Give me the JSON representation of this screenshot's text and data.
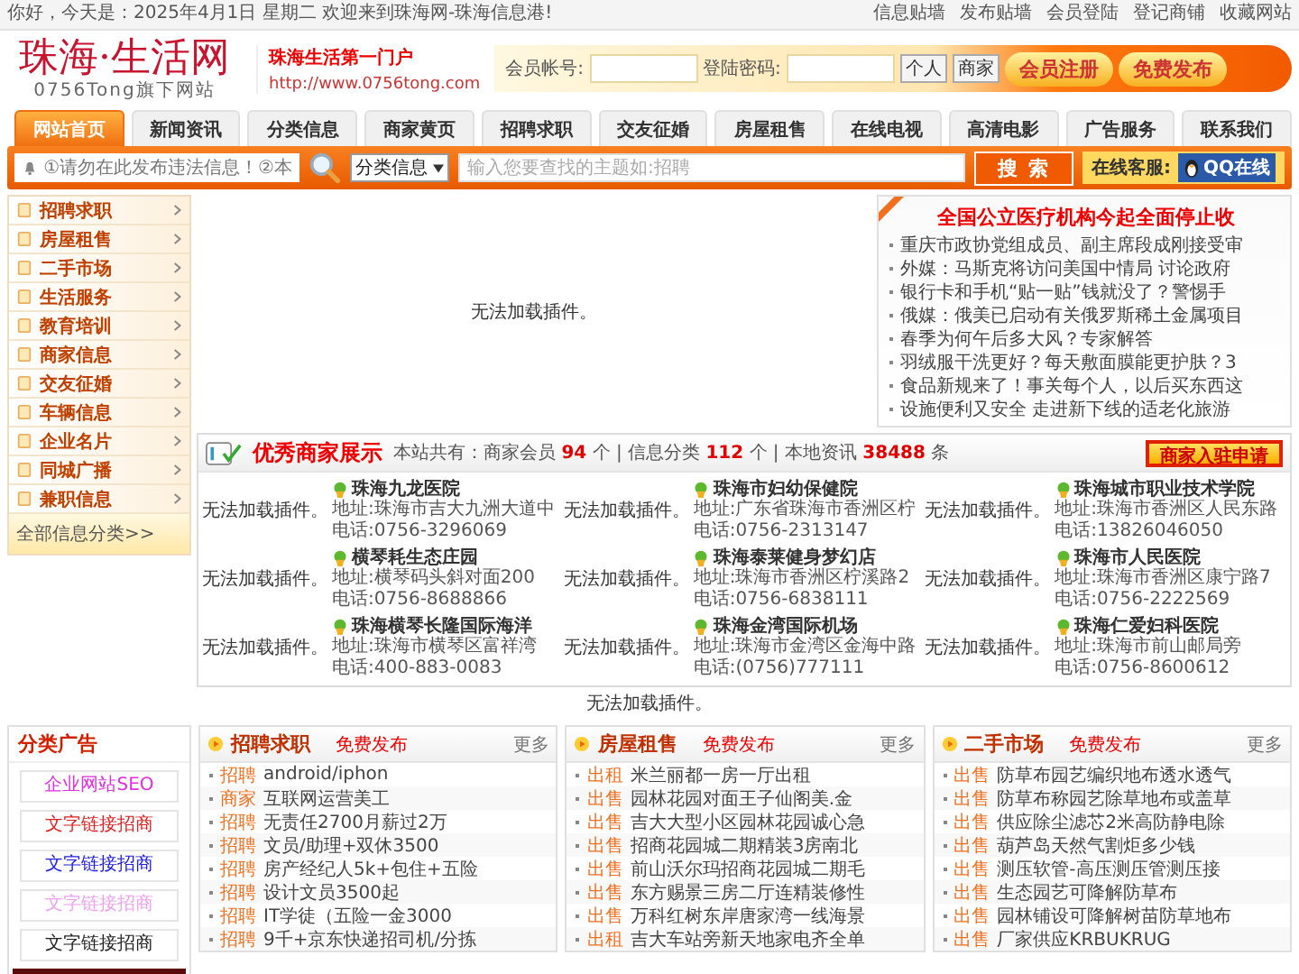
{
  "top_bar": {
    "greeting": "你好，今天是：2025年4月1日 星期二 欢迎来到珠海网-珠海信息港!",
    "links": [
      "信息贴墙",
      "发布贴墙",
      "会员登陆",
      "登记商铺",
      "收藏网站"
    ]
  },
  "header": {
    "logo": "珠海·生活网",
    "logo_subtitle": "0756Tong旗下网站",
    "slogan": "珠海生活第一门户",
    "url": "http://www.0756tong.com",
    "login": {
      "account_label": "会员帐号:",
      "password_label": "登陆密码:",
      "type_buttons": [
        "个人",
        "商家"
      ],
      "buttons": [
        "会员注册",
        "免费发布"
      ]
    }
  },
  "nav": [
    {
      "label": "网站首页",
      "selected": true
    },
    {
      "label": "新闻资讯",
      "selected": false
    },
    {
      "label": "分类信息",
      "selected": false
    },
    {
      "label": "商家黄页",
      "selected": false
    },
    {
      "label": "招聘求职",
      "selected": false
    },
    {
      "label": "交友征婚",
      "selected": false
    },
    {
      "label": "房屋租售",
      "selected": false
    },
    {
      "label": "在线电视",
      "selected": false
    },
    {
      "label": "高清电影",
      "selected": false
    },
    {
      "label": "广告服务",
      "selected": false
    },
    {
      "label": "联系我们",
      "selected": false
    }
  ],
  "search_bar": {
    "notice": "①请勿在此发布违法信息！②本",
    "category": "分类信息",
    "placeholder": "输入您要查找的主题如:招聘",
    "button": "搜 索",
    "service_label": "在线客服:",
    "qq": "QQ在线"
  },
  "sidebar": {
    "items": [
      "招聘求职",
      "房屋租售",
      "二手市场",
      "生活服务",
      "教育培训",
      "商家信息",
      "交友征婚",
      "车辆信息",
      "企业名片",
      "同城广播",
      "兼职信息"
    ],
    "footer": "全部信息分类>>"
  },
  "center": {
    "plugin_message": "无法加载插件。"
  },
  "news": {
    "title": "全国公立医疗机构今起全面停止收",
    "items": [
      "重庆市政协党组成员、副主席段成刚接受审",
      "外媒：马斯克将访问美国中情局 讨论政府",
      "银行卡和手机“贴一贴”钱就没了？警惕手",
      "俄媒：俄美已启动有关俄罗斯稀土金属项目",
      "春季为何午后多大风？专家解答",
      "羽绒服干洗更好？每天敷面膜能更护肤？3",
      "食品新规来了！事关每个人，以后买东西这",
      "设施便利又安全 走进新下线的适老化旅游"
    ]
  },
  "merchants": {
    "title": "优秀商家展示",
    "stats": "本站共有：商家会员 **94** 个 | 信息分类 **112** 个 | 本地资讯 **38488** 条",
    "apply_button": "商家入驻申请",
    "items": [
      {
        "plugin_message": "无法加载插件。",
        "name": "珠海九龙医院",
        "address": "地址:珠海市吉大九洲大道中",
        "phone": "电话:0756-3296069"
      },
      {
        "plugin_message": "无法加载插件。",
        "name": "珠海市妇幼保健院",
        "address": "地址:广东省珠海市香洲区柠",
        "phone": "电话:0756-2313147"
      },
      {
        "plugin_message": "无法加载插件。",
        "name": "珠海城市职业技术学院",
        "address": "地址:珠海市香洲区人民东路",
        "phone": "电话:13826046050"
      },
      {
        "plugin_message": "无法加载插件。",
        "name": "横琴耗生态庄园",
        "address": "地址:横琴码头斜对面200",
        "phone": "电话:0756-8688866"
      },
      {
        "plugin_message": "无法加载插件。",
        "name": "珠海泰莱健身梦幻店",
        "address": "地址:珠海市香洲区柠溪路2",
        "phone": "电话:0756-6838111"
      },
      {
        "plugin_message": "无法加载插件。",
        "name": "珠海市人民医院",
        "address": "地址:珠海市香洲区康宁路7",
        "phone": "电话:0756-2222569"
      },
      {
        "plugin_message": "无法加载插件。",
        "name": "珠海横琴长隆国际海洋",
        "address": "地址:珠海市横琴区富祥湾",
        "phone": "电话:400-883-0083"
      },
      {
        "plugin_message": "无法加载插件。",
        "name": "珠海金湾国际机场",
        "address": "地址:珠海市金湾区金海中路",
        "phone": "电话:(0756)777111"
      },
      {
        "plugin_message": "无法加载插件。",
        "name": "珠海仁爱妇科医院",
        "address": "地址:珠海市前山邮局旁",
        "phone": "电话:0756-8600612"
      }
    ]
  },
  "banner": {
    "plugin_message": "无法加载插件。"
  },
  "ads": {
    "title": "分类广告",
    "items": [
      {
        "label": "企业网站SEO",
        "color": "#e030e0"
      },
      {
        "label": "文字链接招商",
        "color": "#e02020"
      },
      {
        "label": "文字链接招商",
        "color": "#2020e0"
      },
      {
        "label": "文字链接招商",
        "color": "#f0a0f0"
      },
      {
        "label": "文字链接招商",
        "color": "#222222"
      }
    ]
  },
  "sections": [
    {
      "title": "招聘求职",
      "publish": "免费发布",
      "more": "更多",
      "items": [
        {
          "tag": "招聘",
          "text": "android/iphon"
        },
        {
          "tag": "商家",
          "text": "互联网运营美工"
        },
        {
          "tag": "招聘",
          "text": "无责任2700月薪过2万"
        },
        {
          "tag": "招聘",
          "text": "文员/助理+双休3500"
        },
        {
          "tag": "招聘",
          "text": "房产经纪人5k+包住+五险"
        },
        {
          "tag": "招聘",
          "text": "设计文员3500起"
        },
        {
          "tag": "招聘",
          "text": "IT学徒（五险一金3000"
        },
        {
          "tag": "招聘",
          "text": "9千+京东快递招司机/分拣"
        }
      ]
    },
    {
      "title": "房屋租售",
      "publish": "免费发布",
      "more": "更多",
      "items": [
        {
          "tag": "出租",
          "text": "米兰丽都一房一厅出租"
        },
        {
          "tag": "出售",
          "text": "园林花园对面王子仙阁美.金"
        },
        {
          "tag": "出售",
          "text": "吉大大型小区园林花园诚心急"
        },
        {
          "tag": "出售",
          "text": "招商花园城二期精装3房南北"
        },
        {
          "tag": "出售",
          "text": "前山沃尔玛招商花园城二期毛"
        },
        {
          "tag": "出售",
          "text": "东方赐景三房二厅连精装修性"
        },
        {
          "tag": "出售",
          "text": "万科红树东岸唐家湾一线海景"
        },
        {
          "tag": "出租",
          "text": "吉大车站旁新天地家电齐全单"
        }
      ]
    },
    {
      "title": "二手市场",
      "publish": "免费发布",
      "more": "更多",
      "items": [
        {
          "tag": "出售",
          "text": "防草布园艺编织地布透水透气"
        },
        {
          "tag": "出售",
          "text": "防草布称园艺除草地布或盖草"
        },
        {
          "tag": "出售",
          "text": "供应除尘滤芯2米高防静电除"
        },
        {
          "tag": "出售",
          "text": "葫芦岛天然气割炬多少钱"
        },
        {
          "tag": "出售",
          "text": "测压软管-高压测压管测压接"
        },
        {
          "tag": "出售",
          "text": "生态园艺可降解防草布"
        },
        {
          "tag": "出售",
          "text": "园林铺设可降解树苗防草地布"
        },
        {
          "tag": "出售",
          "text": "厂家供应KRBUKRUG"
        }
      ]
    }
  ]
}
